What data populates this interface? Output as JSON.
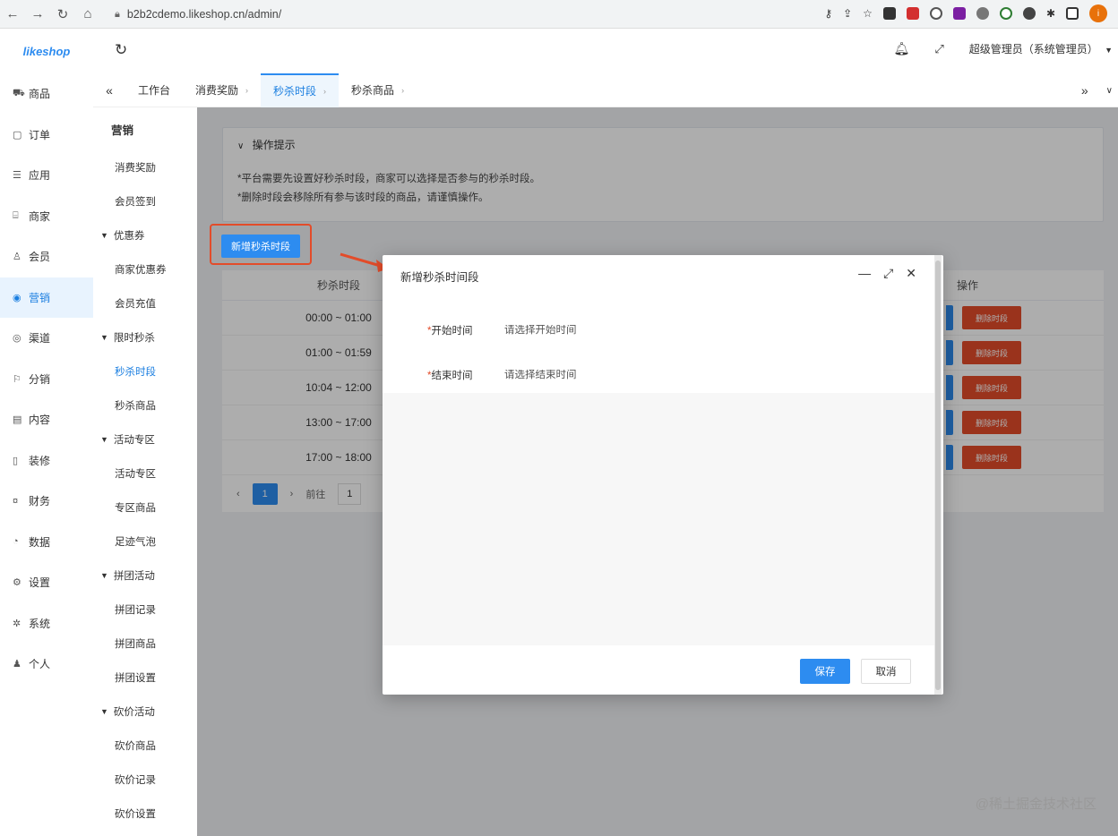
{
  "browser": {
    "url": "b2b2cdemo.likeshop.cn/admin/",
    "avatar_letter": "i"
  },
  "app": {
    "logo": "likeshop",
    "user": "超级管理员（系统管理员）"
  },
  "side_menu": [
    {
      "label": "商品",
      "icon": "cart-icon"
    },
    {
      "label": "订单",
      "icon": "order-icon"
    },
    {
      "label": "应用",
      "icon": "apps-icon"
    },
    {
      "label": "商家",
      "icon": "shop-icon"
    },
    {
      "label": "会员",
      "icon": "user-icon"
    },
    {
      "label": "营销",
      "icon": "marketing-icon"
    },
    {
      "label": "渠道",
      "icon": "channel-icon"
    },
    {
      "label": "分销",
      "icon": "distribution-icon"
    },
    {
      "label": "内容",
      "icon": "content-icon"
    },
    {
      "label": "装修",
      "icon": "decoration-icon"
    },
    {
      "label": "财务",
      "icon": "finance-icon"
    },
    {
      "label": "数据",
      "icon": "data-icon"
    },
    {
      "label": "设置",
      "icon": "settings-icon"
    },
    {
      "label": "系统",
      "icon": "system-icon"
    },
    {
      "label": "个人",
      "icon": "person-icon"
    }
  ],
  "sub_menu": {
    "title": "营销",
    "items": [
      {
        "label": "消费奖励"
      },
      {
        "label": "会员签到"
      },
      {
        "label": "优惠券",
        "group": true
      },
      {
        "label": "商家优惠券"
      },
      {
        "label": "会员充值"
      },
      {
        "label": "限时秒杀",
        "group": true
      },
      {
        "label": "秒杀时段",
        "active": true
      },
      {
        "label": "秒杀商品"
      },
      {
        "label": "活动专区",
        "group": true
      },
      {
        "label": "活动专区"
      },
      {
        "label": "专区商品"
      },
      {
        "label": "足迹气泡"
      },
      {
        "label": "拼团活动",
        "group": true
      },
      {
        "label": "拼团记录"
      },
      {
        "label": "拼团商品"
      },
      {
        "label": "拼团设置"
      },
      {
        "label": "砍价活动",
        "group": true
      },
      {
        "label": "砍价商品"
      },
      {
        "label": "砍价记录"
      },
      {
        "label": "砍价设置"
      }
    ]
  },
  "tabs": [
    {
      "label": "工作台"
    },
    {
      "label": "消费奖励"
    },
    {
      "label": "秒杀时段",
      "active": true
    },
    {
      "label": "秒杀商品"
    }
  ],
  "tips": {
    "title": "操作提示",
    "lines": [
      "*平台需要先设置好秒杀时段，商家可以选择是否参与的秒杀时段。",
      "*删除时段会移除所有参与该时段的商品，请谨慎操作。"
    ]
  },
  "add_button": "新增秒杀时段",
  "table": {
    "headers": {
      "time": "秒杀时段",
      "op": "操作"
    },
    "rows": [
      {
        "time": "00:00 ~ 01:00"
      },
      {
        "time": "01:00 ~ 01:59"
      },
      {
        "time": "10:04 ~ 12:00"
      },
      {
        "time": "13:00 ~ 17:00"
      },
      {
        "time": "17:00 ~ 18:00"
      }
    ],
    "delete_label": "删除时段"
  },
  "pager": {
    "current": "1",
    "goto_label": "前往",
    "goto_value": "1"
  },
  "dialog": {
    "title": "新增秒杀时间段",
    "start_label": "开始时间",
    "start_placeholder": "请选择开始时间",
    "end_label": "结束时间",
    "end_placeholder": "请选择结束时间",
    "save": "保存",
    "cancel": "取消"
  },
  "watermark": "@稀土掘金技术社区"
}
